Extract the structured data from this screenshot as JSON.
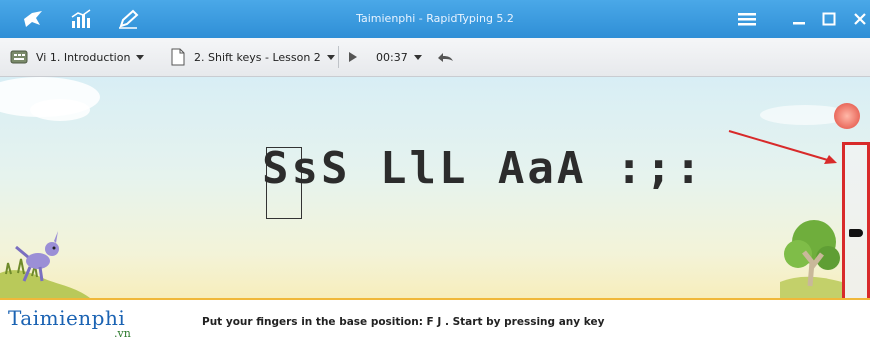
{
  "window": {
    "title": "Taimienphi - RapidTyping 5.2"
  },
  "toolbar": {
    "course": "Vi 1. Introduction",
    "lesson": "2. Shift keys - Lesson 2",
    "timer": "00:37"
  },
  "exercise": {
    "current_char": "S",
    "rest_text": "sS LlL AaA :;:"
  },
  "footer": {
    "logo": "Taimienphi",
    "logo_suffix": ".vn",
    "hint": "Put your fingers in the base position:  F  J .  Start by pressing any key"
  },
  "colors": {
    "titlebar": "#2f8fd6",
    "highlight": "#d82a2a",
    "logo": "#1b63b3"
  }
}
